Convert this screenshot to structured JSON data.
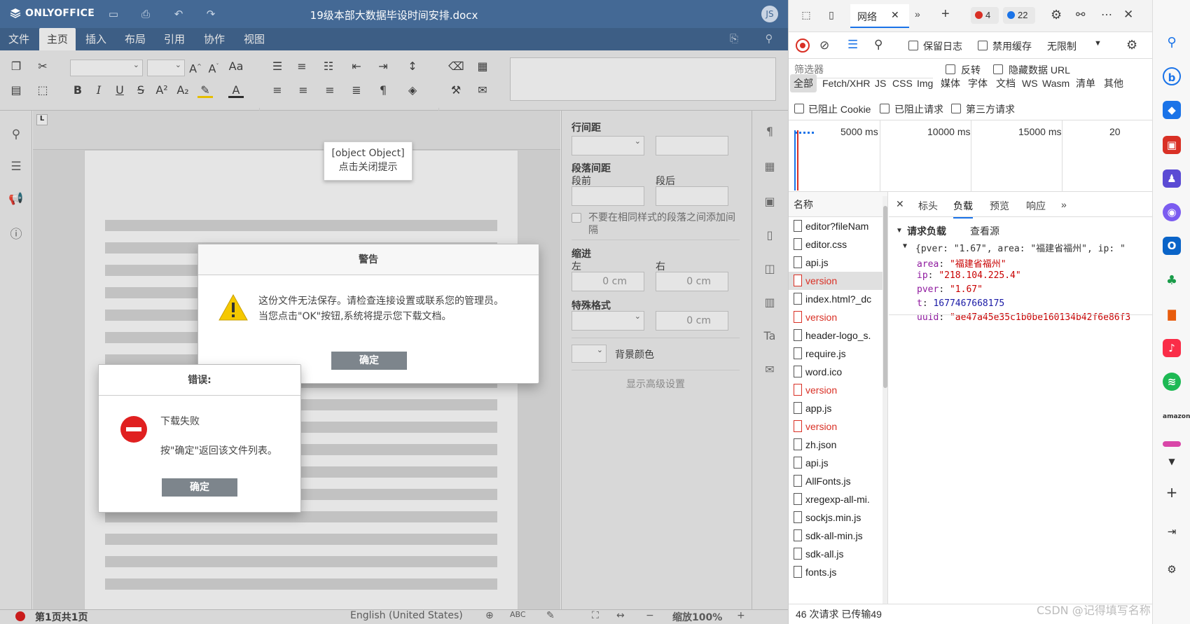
{
  "onlyoffice": {
    "logo": "ONLYOFFICE",
    "doc_title": "19级本部大数据毕设时间安排.docx",
    "avatar": "JS",
    "tabs": [
      "文件",
      "主页",
      "插入",
      "布局",
      "引用",
      "协作",
      "视图"
    ],
    "active_tab": "主页",
    "right_panel": {
      "line_spacing": "行间距",
      "paragraph_spacing": "段落间距",
      "before": "段前",
      "after": "段后",
      "no_space_same_style": "不要在相同样式的段落之间添加间隔",
      "indent": "缩进",
      "left": "左",
      "right": "右",
      "indent_left_value": "0 cm",
      "indent_right_value": "0 cm",
      "special_format": "特殊格式",
      "special_value": "0 cm",
      "bg_color": "背景颜色",
      "advanced": "显示高级设置"
    },
    "tooltip_line1": "[object Object]",
    "tooltip_line2": "点击关闭提示",
    "warning_dialog": {
      "title": "警告",
      "line1": "这份文件无法保存。请检查连接设置或联系您的管理员。",
      "line2": "当您点击\"OK\"按钮,系统将提示您下载文档。",
      "ok": "确定"
    },
    "error_dialog": {
      "title": "错误:",
      "line1": "下载失败",
      "line2": "按\"确定\"返回该文件列表。",
      "ok": "确定"
    },
    "status": {
      "page": "第1页共1页",
      "language": "English (United States)",
      "zoom": "缩放100%"
    }
  },
  "devtools": {
    "network_tab": "网络",
    "errors_badge": "4",
    "messages_badge": "22",
    "preserve_log": "保留日志",
    "disable_cache": "禁用缓存",
    "throttle": "无限制",
    "filter_placeholder": "筛选器",
    "invert": "反转",
    "hide_data_urls": "隐藏数据 URL",
    "type_filters": [
      "全部",
      "Fetch/XHR",
      "JS",
      "CSS",
      "Img",
      "媒体",
      "字体",
      "文档",
      "WS",
      "Wasm",
      "清单",
      "其他"
    ],
    "blocked_cookies": "已阻止 Cookie",
    "blocked_requests": "已阻止请求",
    "third_party": "第三方请求",
    "timeline_labels": [
      "5000 ms",
      "10000 ms",
      "15000 ms",
      "20"
    ],
    "name_header": "名称",
    "requests": [
      {
        "name": "editor?fileNam",
        "red": false
      },
      {
        "name": "editor.css",
        "red": false
      },
      {
        "name": "api.js",
        "red": false
      },
      {
        "name": "version",
        "red": true
      },
      {
        "name": "index.html?_dc",
        "red": false
      },
      {
        "name": "version",
        "red": true
      },
      {
        "name": "header-logo_s.",
        "red": false
      },
      {
        "name": "require.js",
        "red": false
      },
      {
        "name": "word.ico",
        "red": false
      },
      {
        "name": "version",
        "red": true
      },
      {
        "name": "app.js",
        "red": false
      },
      {
        "name": "version",
        "red": true
      },
      {
        "name": "zh.json",
        "red": false
      },
      {
        "name": "api.js",
        "red": false
      },
      {
        "name": "AllFonts.js",
        "red": false
      },
      {
        "name": "xregexp-all-mi.",
        "red": false
      },
      {
        "name": "sockjs.min.js",
        "red": false
      },
      {
        "name": "sdk-all-min.js",
        "red": false
      },
      {
        "name": "sdk-all.js",
        "red": false
      },
      {
        "name": "fonts.js",
        "red": false
      }
    ],
    "detail_tabs": [
      "标头",
      "负载",
      "预览",
      "响应"
    ],
    "active_detail_tab": "负载",
    "payload_section": "请求负载",
    "view_source": "查看源",
    "payload_summary": "{pver: \"1.67\", area: \"福建省福州\", ip: \"",
    "payload": [
      {
        "key": "area",
        "value": "\"福建省福州\"",
        "type": "str"
      },
      {
        "key": "ip",
        "value": "\"218.104.225.4\"",
        "type": "str"
      },
      {
        "key": "pver",
        "value": "\"1.67\"",
        "type": "str"
      },
      {
        "key": "t",
        "value": "1677467668175",
        "type": "num"
      },
      {
        "key": "uuid",
        "value": "\"ae47a45e35c1b0be160134b42f6e86f3",
        "type": "str"
      }
    ],
    "status_bar": "46 次请求  已传输49"
  },
  "watermark": "CSDN @记得填写名称"
}
